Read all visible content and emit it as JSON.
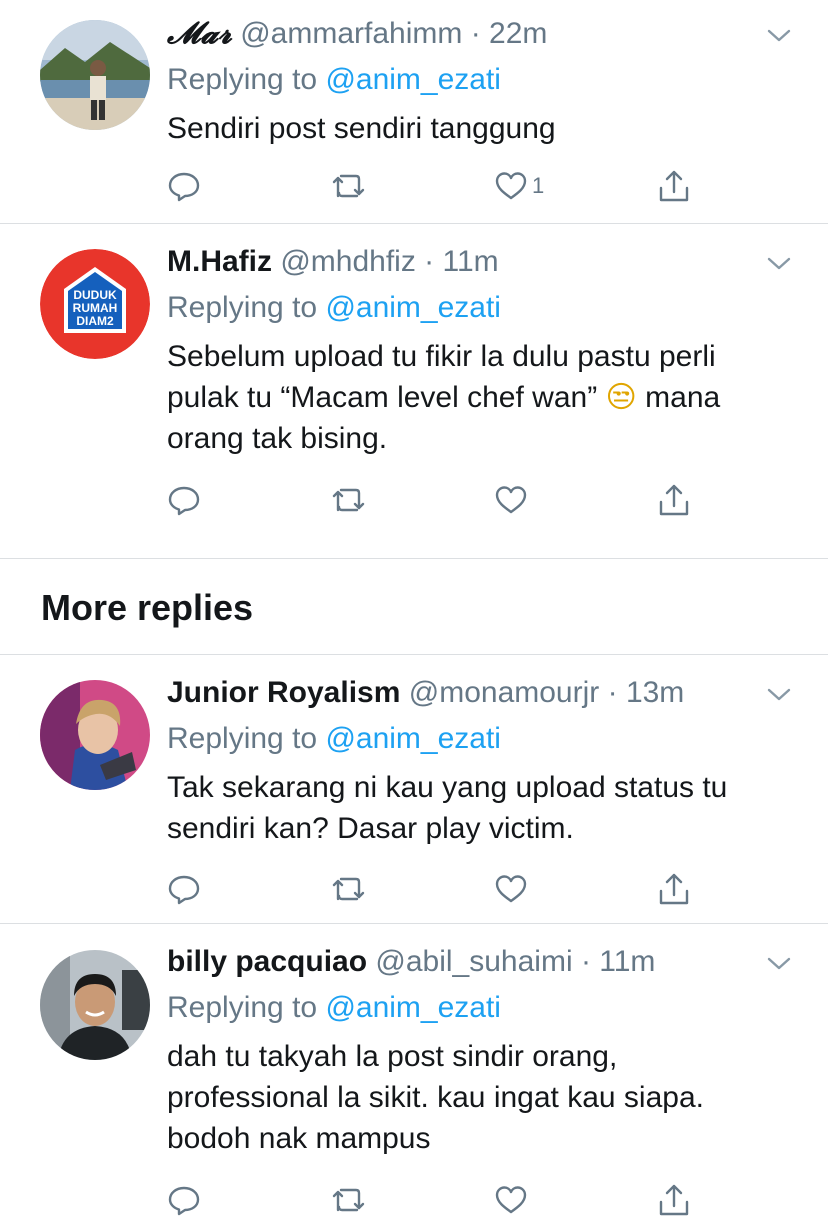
{
  "replies": [
    {
      "name": "𝓜𝓪𝓻",
      "handle": "@ammarfahimm",
      "sep": "·",
      "time": "22m",
      "replying_prefix": "Replying to ",
      "replying_to": "@anim_ezati",
      "text": "Sendiri post sendiri tanggung",
      "like_count": "1",
      "avatar": "photo-beach"
    },
    {
      "name": "M.Hafiz",
      "handle": "@mhdhfiz",
      "sep": "·",
      "time": "11m",
      "replying_prefix": "Replying to ",
      "replying_to": "@anim_ezati",
      "text_line1": "Sebelum upload tu fikir la dulu pastu perli",
      "text_line2a": "pulak tu “Macam level chef wan”",
      "text_line2b": "mana",
      "text_line3": "orang tak bising.",
      "emoji": "😒",
      "like_count": "",
      "avatar": "logo-duduk-rumah-diam2",
      "avatar_text": [
        "DUDUK",
        "RUMAH",
        "DIAM2"
      ]
    }
  ],
  "more_replies_title": "More replies",
  "more_replies": [
    {
      "name": "Junior Royalism",
      "handle": "@monamourjr",
      "sep": "·",
      "time": "13m",
      "replying_prefix": "Replying to ",
      "replying_to": "@anim_ezati",
      "text_line1": "Tak sekarang ni kau yang upload status tu",
      "text_line2": "sendiri kan? Dasar play victim.",
      "like_count": "",
      "avatar": "photo-person"
    },
    {
      "name": "billy pacquiao",
      "handle": "@abil_suhaimi",
      "sep": "·",
      "time": "11m",
      "replying_prefix": "Replying to ",
      "replying_to": "@anim_ezati",
      "text_line1": "dah tu takyah la post sindir orang,",
      "text_line2": "professional la sikit. kau ingat kau siapa.",
      "text_line3": "bodoh nak mampus",
      "like_count": "",
      "avatar": "photo-person-smiling"
    }
  ],
  "colors": {
    "link": "#1da1f2",
    "muted": "#657786",
    "text": "#14171a",
    "divider": "#dcdfe2"
  },
  "icons": [
    "reply-icon",
    "retweet-icon",
    "like-icon",
    "share-icon",
    "chevron-down-icon"
  ]
}
